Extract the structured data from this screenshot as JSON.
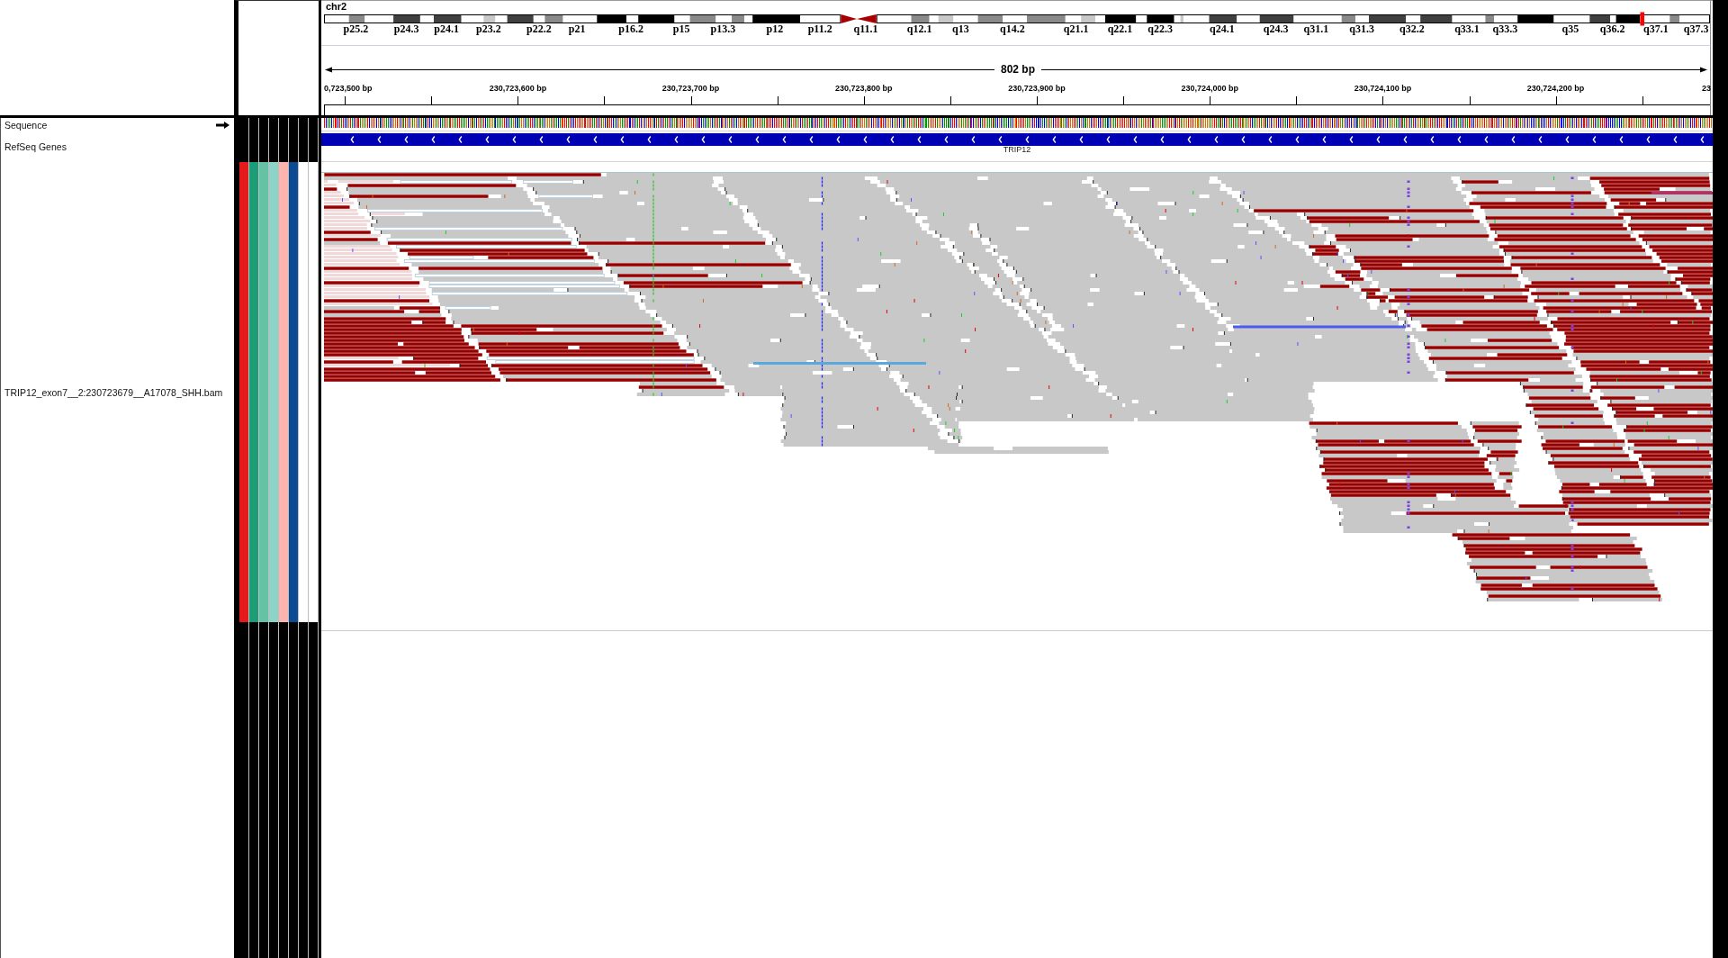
{
  "locus": {
    "chromosome": "chr2",
    "ideogram_bands": [
      "p25.2",
      "p24.3",
      "p24.1",
      "p23.2",
      "p22.2",
      "p21",
      "p16.2",
      "p15",
      "p13.3",
      "p12",
      "p11.2",
      "q11.1",
      "q12.1",
      "q13",
      "q14.2",
      "q21.1",
      "q22.1",
      "q22.3",
      "q24.1",
      "q24.3",
      "q31.1",
      "q31.3",
      "q32.2",
      "q33.1",
      "q33.3",
      "q35",
      "q36.2",
      "q37.1",
      "q37.3"
    ],
    "span": "802 bp",
    "ruler_ticks": [
      "0,723,500 bp",
      "230,723,600 bp",
      "230,723,700 bp",
      "230,723,800 bp",
      "230,723,900 bp",
      "230,724,000 bp",
      "230,724,100 bp",
      "230,724,200 bp",
      "23"
    ]
  },
  "tracks": [
    {
      "kind": "sequence",
      "name": "Sequence",
      "reverse_strand": false
    },
    {
      "kind": "gene",
      "name": "RefSeq Genes",
      "feature": {
        "label": "TRIP12",
        "reverse_strand": true
      }
    },
    {
      "kind": "alignment",
      "name": "TRIP12_exon7__2:230723679__A17078_SHH.bam",
      "attributes": [
        {
          "color": "#e41a1c"
        },
        {
          "color": "#1b9e77"
        },
        {
          "color": "#66c2a5"
        },
        {
          "color": "#8dd3c7"
        },
        {
          "color": "#fbb4ae"
        },
        {
          "color": "#0c4a94"
        },
        {
          "color": "#ffffff"
        },
        {
          "color": "#ffffff"
        }
      ]
    }
  ]
}
